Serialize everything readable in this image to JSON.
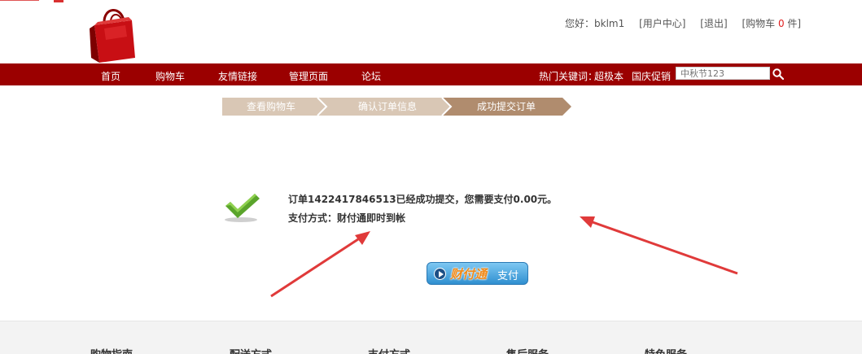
{
  "header": {
    "greeting": "您好：bklm1",
    "user_center": "[用户中心]",
    "logout": "[退出]",
    "cart_prefix": "[购物车 ",
    "cart_count": "0",
    "cart_suffix": " 件]"
  },
  "nav": {
    "items": [
      "首页",
      "购物车",
      "友情链接",
      "管理页面",
      "论坛"
    ],
    "hot_label": "热门关键词：",
    "hot_keywords": [
      "超极本",
      "国庆促销"
    ],
    "search_placeholder": "中秋节123"
  },
  "steps": [
    "查看购物车",
    "确认订单信息",
    "成功提交订单"
  ],
  "order": {
    "message": "订单1422417846513已经成功提交，您需要支付0.00元。",
    "payment_method": "支付方式：财付通即时到帐"
  },
  "pay_button": {
    "brand": "财付通",
    "label": "支付"
  },
  "footer": {
    "columns": [
      "购物指南",
      "配送方式",
      "支付方式",
      "售后服务",
      "特色服务"
    ]
  },
  "colors": {
    "nav_bg": "#9b0000",
    "step_inactive": "#d9c7b5",
    "step_active": "#b08c6e",
    "arrow": "#e03a3a"
  }
}
